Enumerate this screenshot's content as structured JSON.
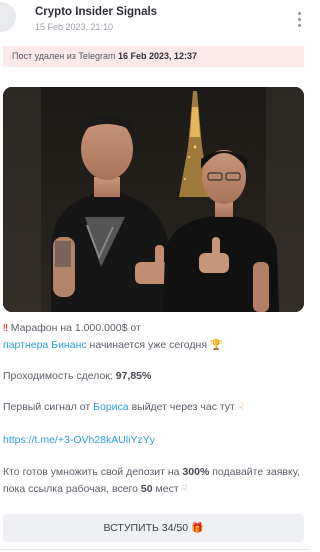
{
  "header": {
    "channel_name": "Crypto Insider Signals",
    "post_date": "15 Feb 2023, 21:10"
  },
  "deleted_notice": {
    "text": "Пост удален из Telegram",
    "date": "16 Feb 2023, 12:37"
  },
  "message": {
    "line1_prefix": "Марафон на 1.000.000$ от",
    "partner_link": "партнера Бинанс",
    "line1_suffix": "начинается уже сегодня",
    "pass_rate_label": "Проходимость сделок:",
    "pass_rate_value": "97,85%",
    "signal_prefix": "Первый сигнал от",
    "signal_link": "Бориса",
    "signal_suffix": "выйдет через час тут",
    "invite_url": "https://t.me/+3-OVh28kAUliYzYy",
    "cta_part1": "Кто готов умножить свой депозит на",
    "cta_value1": "300%",
    "cta_part2": "подавайте заявку, пока ссылка рабочая, всего",
    "cta_value2": "50",
    "cta_part3": "мест"
  },
  "join_button": {
    "label": "ВСТУПИТЬ 34/50"
  },
  "icons": {
    "alert": "double-exclamation-icon",
    "trophy": "trophy-icon",
    "pointing": "pointing-down-hand-icon",
    "gift": "gift-icon"
  },
  "colors": {
    "link": "#2d9ed8",
    "banner_bg": "#fde8ea",
    "button_bg": "#eef0f4"
  }
}
